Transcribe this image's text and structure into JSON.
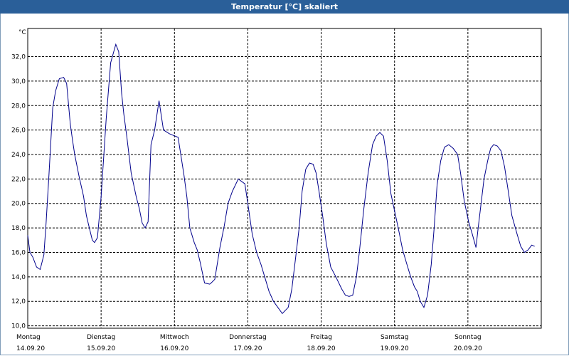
{
  "window": {
    "title": "Temperatur [°C] skaliert"
  },
  "chart_data": {
    "type": "line",
    "title": "Temperatur [°C] skaliert",
    "ylabel": "°C",
    "xlabel": "",
    "ylim": [
      9.8,
      34.3
    ],
    "xlim": [
      0,
      7
    ],
    "grid": true,
    "line_color": "#00008b",
    "yticks": [
      "10,0",
      "12,0",
      "14,0",
      "16,0",
      "18,0",
      "20,0",
      "22,0",
      "24,0",
      "26,0",
      "28,0",
      "30,0",
      "32,0"
    ],
    "ytick_values": [
      10,
      12,
      14,
      16,
      18,
      20,
      22,
      24,
      26,
      28,
      30,
      32
    ],
    "days": [
      {
        "day": "Montag",
        "date": "14.09.20"
      },
      {
        "day": "Dienstag",
        "date": "15.09.20"
      },
      {
        "day": "Mittwoch",
        "date": "16.09.20"
      },
      {
        "day": "Donnerstag",
        "date": "17.09.20"
      },
      {
        "day": "Freitag",
        "date": "18.09.20"
      },
      {
        "day": "Samstag",
        "date": "19.09.20"
      },
      {
        "day": "Sonntag",
        "date": "20.09.20"
      }
    ],
    "series": [
      {
        "x": [
          0,
          0.03,
          0.07,
          0.12,
          0.17,
          0.22,
          0.25,
          0.29,
          0.34,
          0.38,
          0.43,
          0.49,
          0.53,
          0.58,
          0.61,
          0.64,
          0.7,
          0.76,
          0.8,
          0.84,
          0.88,
          0.91,
          0.95,
          1.0,
          1.07,
          1.13,
          1.2,
          1.24,
          1.28,
          1.31,
          1.35,
          1.41,
          1.48,
          1.52,
          1.56,
          1.6,
          1.64,
          1.68,
          1.73,
          1.79,
          1.85,
          1.93,
          2.05,
          2.13,
          2.17,
          2.21,
          2.27,
          2.31,
          2.35,
          2.41,
          2.48,
          2.5,
          2.55,
          2.62,
          2.68,
          2.73,
          2.79,
          2.87,
          2.96,
          3.0,
          3.06,
          3.12,
          3.18,
          3.24,
          3.29,
          3.35,
          3.41,
          3.47,
          3.55,
          3.6,
          3.65,
          3.7,
          3.74,
          3.79,
          3.84,
          3.89,
          3.93,
          3.97,
          4.02,
          4.07,
          4.13,
          4.2,
          4.28,
          4.33,
          4.38,
          4.43,
          4.48,
          4.52,
          4.58,
          4.64,
          4.7,
          4.75,
          4.8,
          4.85,
          4.9,
          4.95,
          5.0,
          5.05,
          5.11,
          5.17,
          5.22,
          5.27,
          5.31,
          5.35,
          5.4,
          5.45,
          5.5,
          5.54,
          5.58,
          5.63,
          5.68,
          5.74,
          5.8,
          5.86,
          5.9,
          5.95,
          6.01,
          6.06,
          6.11,
          6.14,
          6.18,
          6.22,
          6.27,
          6.31,
          6.35,
          6.4,
          6.45,
          6.5,
          6.55,
          6.6,
          6.67,
          6.72,
          6.77,
          6.82,
          6.87,
          6.91
        ],
        "y": [
          17.4,
          16.0,
          15.6,
          14.8,
          14.6,
          15.8,
          18.4,
          22.4,
          27.8,
          29.2,
          30.2,
          30.3,
          29.8,
          26.5,
          25.2,
          24.0,
          22.2,
          20.6,
          19.0,
          18.0,
          17.0,
          16.8,
          17.2,
          20.5,
          27.0,
          31.5,
          33.0,
          32.4,
          29.0,
          27.3,
          25.5,
          22.5,
          20.5,
          19.6,
          18.4,
          18.0,
          18.5,
          24.8,
          26.0,
          28.4,
          26.0,
          25.7,
          25.4,
          22.3,
          20.5,
          18.0,
          16.8,
          16.2,
          15.2,
          13.5,
          13.4,
          13.5,
          13.8,
          16.4,
          18.2,
          20.0,
          21.0,
          22.0,
          21.6,
          20.0,
          17.5,
          16.0,
          15.0,
          13.8,
          12.8,
          12.0,
          11.5,
          11.0,
          11.5,
          13.0,
          15.5,
          18.0,
          21.0,
          22.8,
          23.3,
          23.2,
          22.5,
          21.0,
          19.0,
          16.7,
          14.8,
          14.0,
          13.0,
          12.5,
          12.4,
          12.5,
          14.0,
          16.0,
          19.5,
          22.5,
          24.8,
          25.5,
          25.8,
          25.5,
          23.5,
          20.8,
          19.4,
          18.0,
          16.2,
          15.0,
          14.0,
          13.2,
          12.8,
          12.0,
          11.5,
          12.5,
          15.0,
          18.0,
          21.5,
          23.5,
          24.6,
          24.8,
          24.5,
          24.0,
          22.5,
          20.2,
          18.5,
          17.5,
          16.4,
          18.0,
          20.0,
          22.0,
          23.5,
          24.5,
          24.8,
          24.7,
          24.3,
          23.0,
          21.0,
          19.0,
          17.5,
          16.5,
          16.0,
          16.2,
          16.6,
          16.5
        ]
      }
    ]
  }
}
